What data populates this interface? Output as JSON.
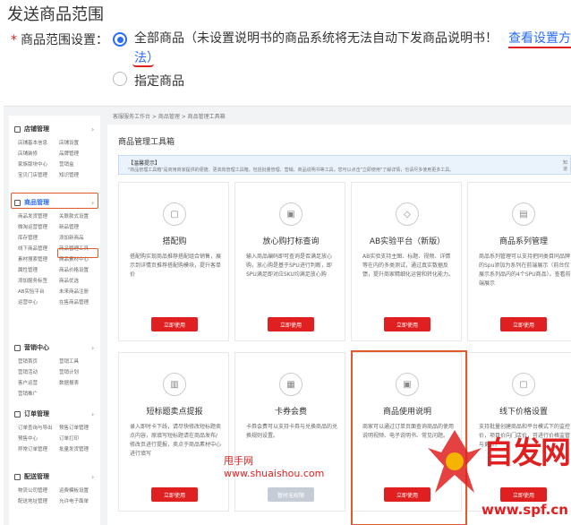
{
  "header": {
    "title": "发送商品范围",
    "range_label": "商品范围设置：",
    "required_mark": "*",
    "option_all": "全部商品（未设置说明书的商品系统将无法自动下发商品说明书！",
    "option_all_link_a": "查看设置方",
    "option_all_link_b": "法）",
    "option_specified": "指定商品"
  },
  "shot": {
    "breadcrumb": "客服服务工作台 > 商品管理 > 商品管理工具箱",
    "toolbox_title": "商品管理工具箱",
    "tip_title": "【温馨提示】",
    "tip_body": "\"商品管理工具箱\"是商用商家提供的便捷、更高效管理工具箱，包括批量管理、营销、商品说明书等工具，您可以点击\"立即使用\"了解详情，也请尽多使用更多工具。",
    "tip_right": "知道",
    "sidebar": [
      {
        "title": "店铺管理",
        "items": [
          "店铺基本信息",
          "店铺设置",
          "店铺装修",
          "品牌管理",
          "家族版块中心",
          "营销盒",
          "宝贝门店管理",
          "知识管理"
        ]
      },
      {
        "title": "商品管理",
        "items": [
          "商品发货管理",
          "关联款式设置",
          "微淘运营管理",
          "新品管理",
          "库存管理",
          "添加新商品",
          "线下商品管理",
          "商品管理工具",
          "素材搜索管理",
          "商品素材中心",
          "属性管理",
          "商品价格设置",
          "添加服务标签",
          "商品优选",
          "AB实验平台",
          "未来商品注册",
          "运营中心",
          "在售商品管理"
        ]
      },
      {
        "title": "营销中心",
        "items": [
          "营销首页",
          "营销工具",
          "营销活动",
          "营销计划",
          "客户运营",
          "数据报表",
          "营销推广"
        ]
      },
      {
        "title": "订单管理",
        "items": [
          "订单查询与导出",
          "预售订单管理",
          "预售中心",
          "订单打印",
          "异常订单管理",
          "批量发货管理"
        ]
      },
      {
        "title": "配送管理",
        "items": [
          "物流公司管理",
          "运费模板设置",
          "配送地址管理",
          "允许电子面单"
        ]
      }
    ],
    "cards": [
      {
        "title": "搭配购",
        "desc": "搭配购实现商品推荐搭配组合销售，展示到详情页推荐搭配购模块，提升客单价",
        "button": "立即使用"
      },
      {
        "title": "放心购打标查询",
        "desc": "输入商品编码即可查询是否满足放心购，放心购是基于SPU进行判断，即SPU满足即对应SKU均满足放心购",
        "button": "立即使用"
      },
      {
        "title": "AB实验平台（新版）",
        "desc": "AB实验支持主图、标题、视频、详情等在内的多类测试，通过真实数据反馈，提升商家精细化运营和转化能力。",
        "button": "立即使用"
      },
      {
        "title": "商品系列管理",
        "desc": "商品系列管理可以支持把同类目同品牌的Spu添加为系列在前端展示（前台仅展示系列品内的4个SPU商品）。查看前端展示",
        "button": "立即使用"
      },
      {
        "title": "短标题卖点提报",
        "desc": "录入即时卡下线，请尽快修改短标题卖点内容，原填写短标题请在商品发布/修改页进行提报，卖点于商品素材中心进行填写",
        "button": "立即使用"
      },
      {
        "title": "卡券会费",
        "desc": "卡券会费可以支持卡券与兑换商品的兑换规则设置。",
        "button": "暂时无权限"
      },
      {
        "title": "商品使用说明",
        "desc": "商家可以通过订单页面查询商品的使用说明视频、电子说明书、常见问题。",
        "button": "立即使用"
      },
      {
        "title": "线下价格设置",
        "desc": "支持批量创建商品和平台模式下的监控价，项目价向门店价，可进行价格监管与更新。",
        "button": "立即使用"
      }
    ]
  },
  "watermark": {
    "cn": "甩手网",
    "url": "www.shuaishou.com",
    "logo_text": "自发网",
    "logo_url": "www.spf.cn"
  },
  "colors": {
    "accent": "#2a6cf5",
    "danger": "#e02020",
    "highlight": "#e05a2b"
  }
}
